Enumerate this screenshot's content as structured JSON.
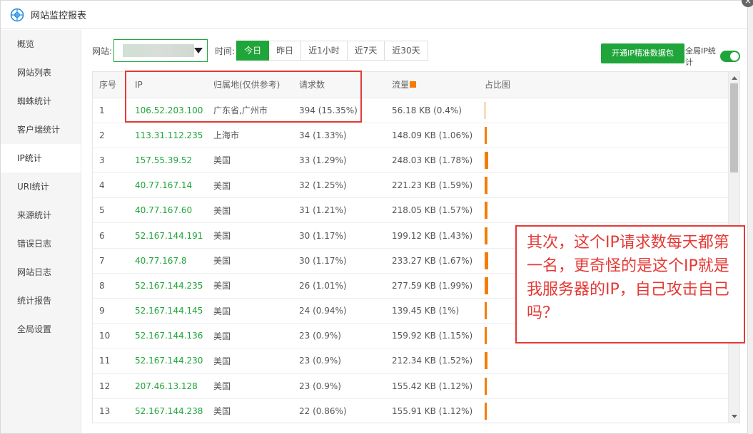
{
  "window": {
    "title": "网站监控报表"
  },
  "sidebar": {
    "items": [
      {
        "label": "概览"
      },
      {
        "label": "网站列表"
      },
      {
        "label": "蜘蛛统计"
      },
      {
        "label": "客户端统计"
      },
      {
        "label": "IP统计",
        "active": true
      },
      {
        "label": "URI统计"
      },
      {
        "label": "来源统计"
      },
      {
        "label": "错误日志"
      },
      {
        "label": "网站日志"
      },
      {
        "label": "统计报告"
      },
      {
        "label": "全局设置"
      }
    ]
  },
  "toolbar": {
    "site_label": "网站:",
    "time_label": "时间:",
    "tabs": [
      "今日",
      "昨日",
      "近1小时",
      "近7天",
      "近30天"
    ],
    "active_tab": "今日",
    "buy_button": "开通IP精准数据包",
    "global_toggle_label": "全局IP统计",
    "global_toggle_on": true
  },
  "table": {
    "headers": [
      "序号",
      "IP",
      "归属地(仅供参考)",
      "请求数",
      "流量",
      "占比图"
    ],
    "rows": [
      {
        "no": "1",
        "ip": "106.52.203.100",
        "location": "广东省,广州市",
        "requests": "394 (15.35%)",
        "traffic": "56.18 KB (0.4%)",
        "share": 0.4
      },
      {
        "no": "2",
        "ip": "113.31.112.235",
        "location": "上海市",
        "requests": "34 (1.33%)",
        "traffic": "148.09 KB (1.06%)",
        "share": 1.06
      },
      {
        "no": "3",
        "ip": "157.55.39.52",
        "location": "美国",
        "requests": "33 (1.29%)",
        "traffic": "248.03 KB (1.78%)",
        "share": 1.78
      },
      {
        "no": "4",
        "ip": "40.77.167.14",
        "location": "美国",
        "requests": "32 (1.25%)",
        "traffic": "221.23 KB (1.59%)",
        "share": 1.59
      },
      {
        "no": "5",
        "ip": "40.77.167.60",
        "location": "美国",
        "requests": "31 (1.21%)",
        "traffic": "218.05 KB (1.57%)",
        "share": 1.57
      },
      {
        "no": "6",
        "ip": "52.167.144.191",
        "location": "美国",
        "requests": "30 (1.17%)",
        "traffic": "199.12 KB (1.43%)",
        "share": 1.43
      },
      {
        "no": "7",
        "ip": "40.77.167.8",
        "location": "美国",
        "requests": "30 (1.17%)",
        "traffic": "233.27 KB (1.67%)",
        "share": 1.67
      },
      {
        "no": "8",
        "ip": "52.167.144.235",
        "location": "美国",
        "requests": "26 (1.01%)",
        "traffic": "277.59 KB (1.99%)",
        "share": 1.99
      },
      {
        "no": "9",
        "ip": "52.167.144.145",
        "location": "美国",
        "requests": "24 (0.94%)",
        "traffic": "139.45 KB (1%)",
        "share": 1.0
      },
      {
        "no": "10",
        "ip": "52.167.144.136",
        "location": "美国",
        "requests": "23 (0.9%)",
        "traffic": "159.92 KB (1.15%)",
        "share": 1.15
      },
      {
        "no": "11",
        "ip": "52.167.144.230",
        "location": "美国",
        "requests": "23 (0.9%)",
        "traffic": "212.34 KB (1.52%)",
        "share": 1.52
      },
      {
        "no": "12",
        "ip": "207.46.13.128",
        "location": "美国",
        "requests": "23 (0.9%)",
        "traffic": "155.42 KB (1.12%)",
        "share": 1.12
      },
      {
        "no": "13",
        "ip": "52.167.144.238",
        "location": "美国",
        "requests": "22 (0.86%)",
        "traffic": "155.91 KB (1.12%)",
        "share": 1.12
      }
    ]
  },
  "annotation": {
    "text": "其次，这个IP请求数每天都第一名，更奇怪的是这个IP就是我服务器的IP，自己攻击自己吗？"
  },
  "colors": {
    "accent": "#20a53a",
    "bar": "#f57c00",
    "annotation": "#e53935"
  }
}
